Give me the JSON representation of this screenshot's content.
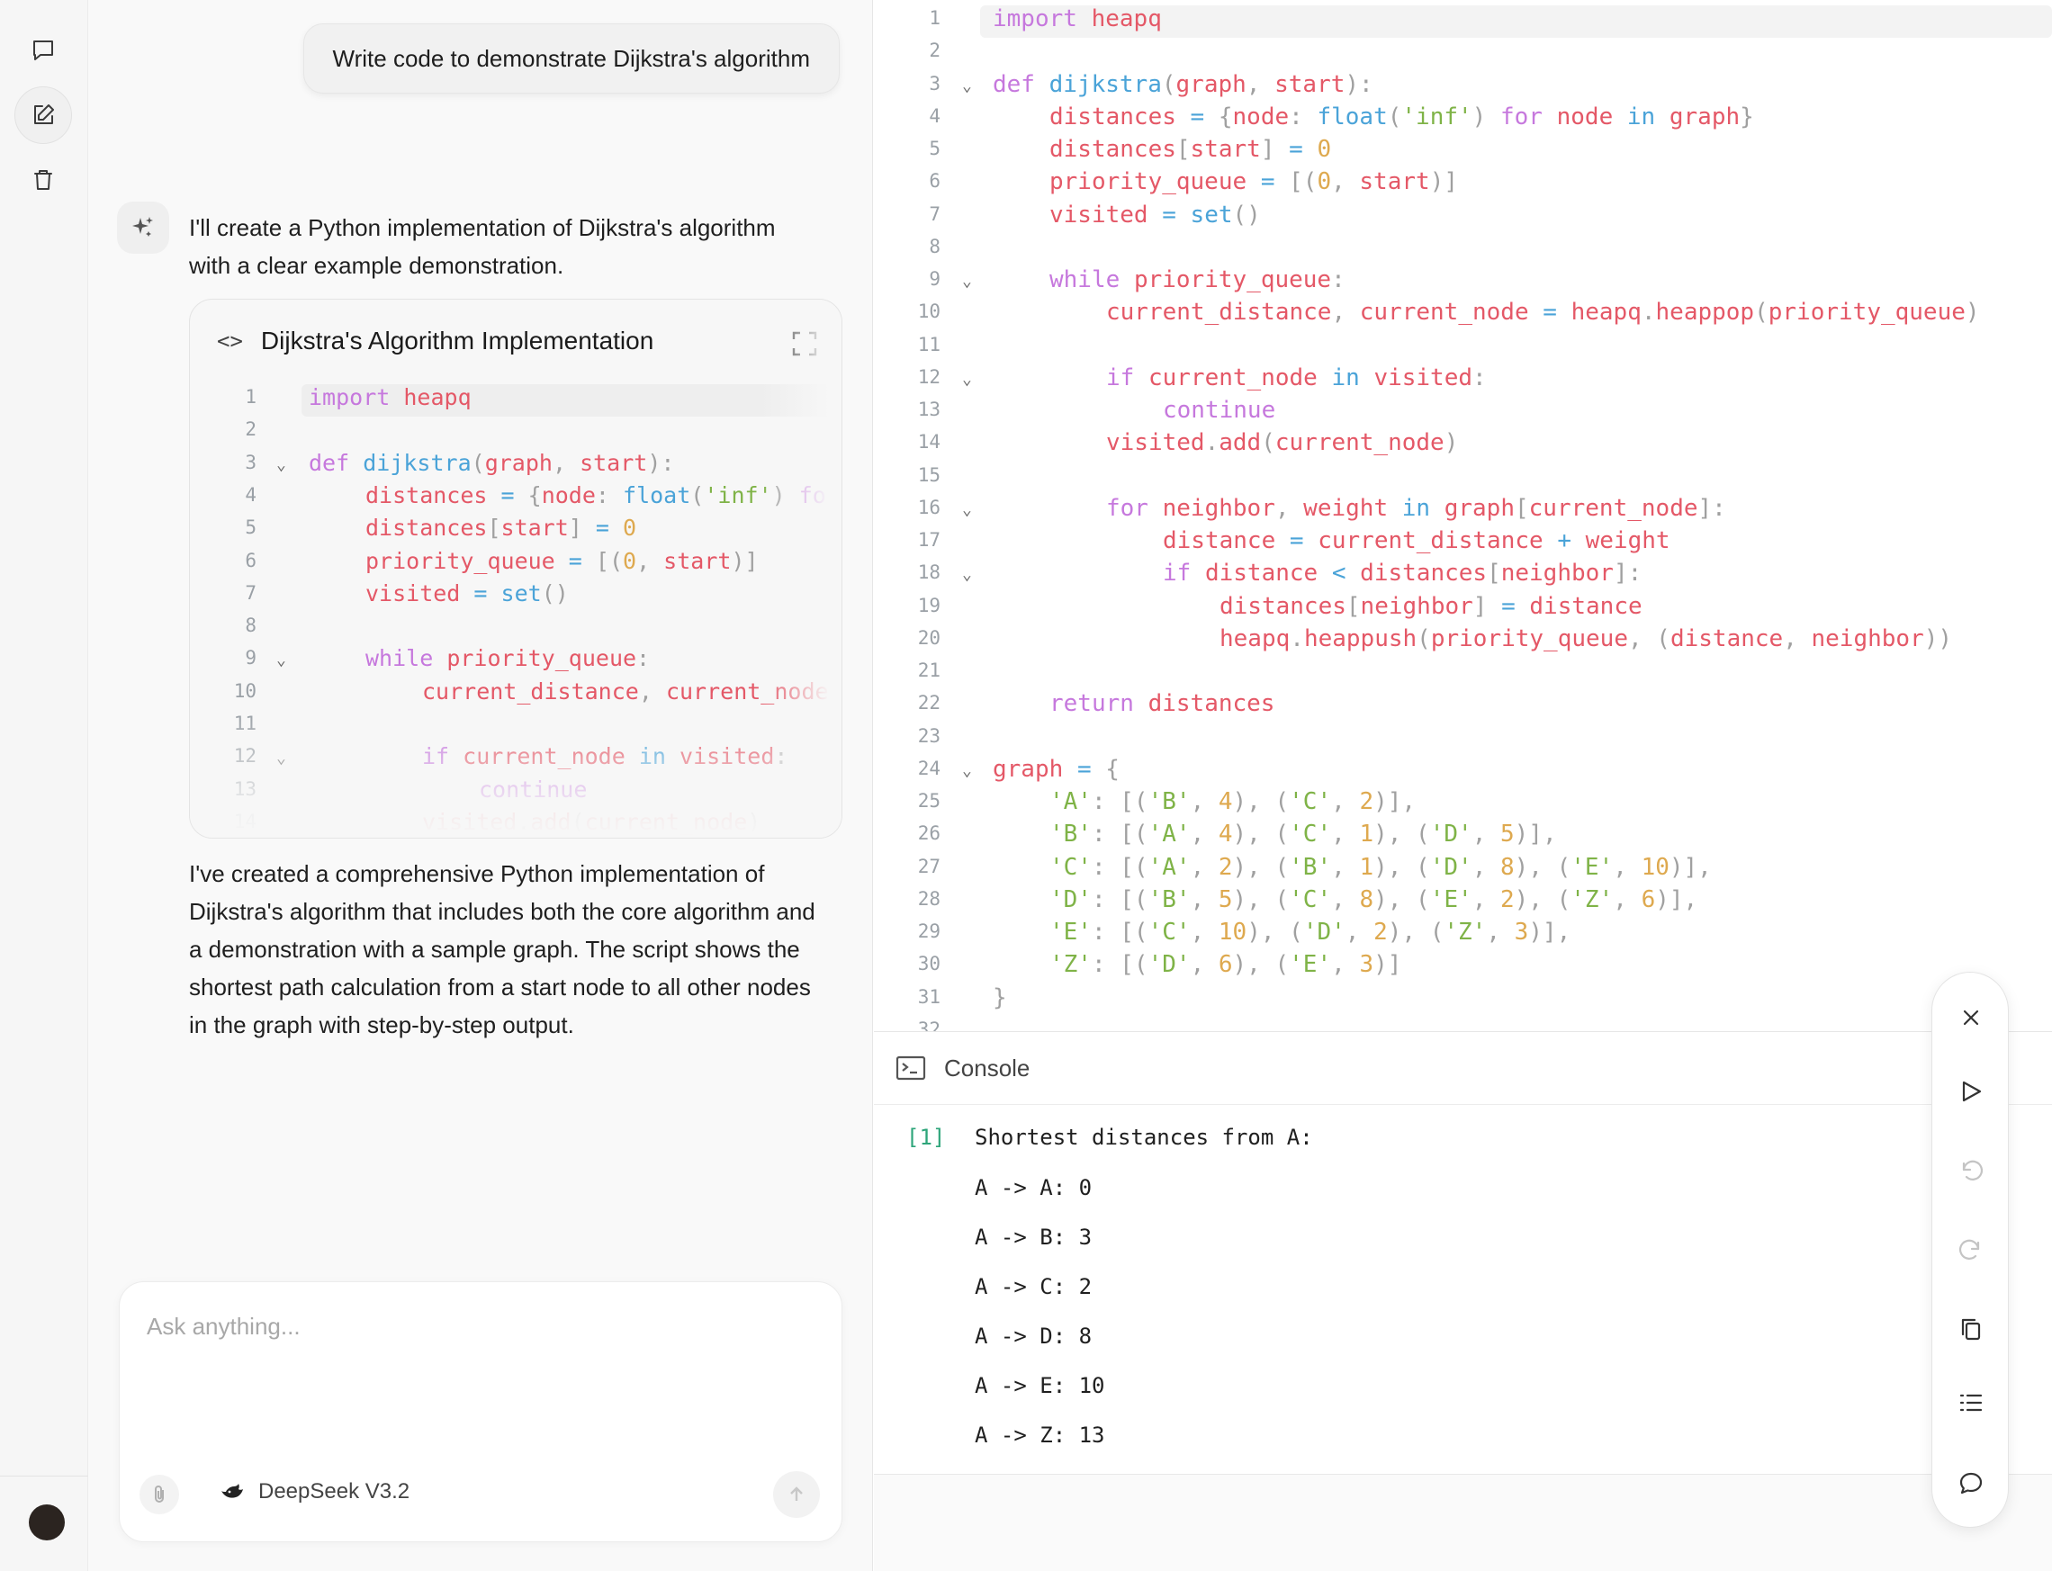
{
  "rail": {
    "items": [
      {
        "name": "chat-icon"
      },
      {
        "name": "new-chat-icon"
      },
      {
        "name": "trash-icon"
      }
    ]
  },
  "chat": {
    "user_message": "Write code to demonstrate Dijkstra's algorithm",
    "assistant_intro": "I'll create a Python implementation of Dijkstra's algorithm with a clear example demonstration.",
    "artifact_title": "Dijkstra's Algorithm Implementation",
    "artifact_icon": "code-icon",
    "assistant_outro": "I've created a comprehensive Python implementation of Dijkstra's algorithm that includes both the core algorithm and a demonstration with a sample graph. The script shows the shortest path calculation from a start node to all other nodes in the graph with step-by-step output.",
    "input_placeholder": "Ask anything...",
    "model_name": "DeepSeek V3.2"
  },
  "editor": {
    "lines": [
      {
        "n": "1",
        "fold": false,
        "indent": 0,
        "tokens": [
          [
            "kw",
            "import"
          ],
          [
            "pn",
            " "
          ],
          [
            "vr",
            "heapq"
          ]
        ]
      },
      {
        "n": "2",
        "fold": false,
        "indent": 0,
        "tokens": []
      },
      {
        "n": "3",
        "fold": true,
        "indent": 0,
        "tokens": [
          [
            "kw",
            "def"
          ],
          [
            "pn",
            " "
          ],
          [
            "fn",
            "dijkstra"
          ],
          [
            "pn",
            "("
          ],
          [
            "vr",
            "graph"
          ],
          [
            "pn",
            ", "
          ],
          [
            "vr",
            "start"
          ],
          [
            "pn",
            "):"
          ]
        ]
      },
      {
        "n": "4",
        "fold": false,
        "indent": 1,
        "tokens": [
          [
            "vr",
            "distances"
          ],
          [
            "pn",
            " "
          ],
          [
            "op",
            "="
          ],
          [
            "pn",
            " {"
          ],
          [
            "vr",
            "node"
          ],
          [
            "pn",
            ": "
          ],
          [
            "fn",
            "float"
          ],
          [
            "pn",
            "("
          ],
          [
            "st",
            "'inf'"
          ],
          [
            "pn",
            ") "
          ],
          [
            "kw",
            "for"
          ],
          [
            "pn",
            " "
          ],
          [
            "vr",
            "node"
          ],
          [
            "pn",
            " "
          ],
          [
            "op",
            "in"
          ],
          [
            "pn",
            " "
          ],
          [
            "vr",
            "graph"
          ],
          [
            "pn",
            "}"
          ]
        ]
      },
      {
        "n": "5",
        "fold": false,
        "indent": 1,
        "tokens": [
          [
            "vr",
            "distances"
          ],
          [
            "pn",
            "["
          ],
          [
            "vr",
            "start"
          ],
          [
            "pn",
            "] "
          ],
          [
            "op",
            "="
          ],
          [
            "pn",
            " "
          ],
          [
            "nm",
            "0"
          ]
        ]
      },
      {
        "n": "6",
        "fold": false,
        "indent": 1,
        "tokens": [
          [
            "vr",
            "priority_queue"
          ],
          [
            "pn",
            " "
          ],
          [
            "op",
            "="
          ],
          [
            "pn",
            " [("
          ],
          [
            "nm",
            "0"
          ],
          [
            "pn",
            ", "
          ],
          [
            "vr",
            "start"
          ],
          [
            "pn",
            ")]"
          ]
        ]
      },
      {
        "n": "7",
        "fold": false,
        "indent": 1,
        "tokens": [
          [
            "vr",
            "visited"
          ],
          [
            "pn",
            " "
          ],
          [
            "op",
            "="
          ],
          [
            "pn",
            " "
          ],
          [
            "fn",
            "set"
          ],
          [
            "pn",
            "()"
          ]
        ]
      },
      {
        "n": "8",
        "fold": false,
        "indent": 0,
        "tokens": []
      },
      {
        "n": "9",
        "fold": true,
        "indent": 1,
        "tokens": [
          [
            "kw",
            "while"
          ],
          [
            "pn",
            " "
          ],
          [
            "vr",
            "priority_queue"
          ],
          [
            "pn",
            ":"
          ]
        ]
      },
      {
        "n": "10",
        "fold": false,
        "indent": 2,
        "tokens": [
          [
            "vr",
            "current_distance"
          ],
          [
            "pn",
            ", "
          ],
          [
            "vr",
            "current_node"
          ],
          [
            "pn",
            " "
          ],
          [
            "op",
            "="
          ],
          [
            "pn",
            " "
          ],
          [
            "vr",
            "heapq"
          ],
          [
            "pn",
            "."
          ],
          [
            "vr",
            "heappop"
          ],
          [
            "pn",
            "("
          ],
          [
            "vr",
            "priority_queue"
          ],
          [
            "pn",
            ")"
          ]
        ]
      },
      {
        "n": "11",
        "fold": false,
        "indent": 0,
        "tokens": []
      },
      {
        "n": "12",
        "fold": true,
        "indent": 2,
        "tokens": [
          [
            "kw",
            "if"
          ],
          [
            "pn",
            " "
          ],
          [
            "vr",
            "current_node"
          ],
          [
            "pn",
            " "
          ],
          [
            "op",
            "in"
          ],
          [
            "pn",
            " "
          ],
          [
            "vr",
            "visited"
          ],
          [
            "pn",
            ":"
          ]
        ]
      },
      {
        "n": "13",
        "fold": false,
        "indent": 3,
        "tokens": [
          [
            "cd",
            "continue"
          ]
        ]
      },
      {
        "n": "14",
        "fold": false,
        "indent": 2,
        "tokens": [
          [
            "vr",
            "visited"
          ],
          [
            "pn",
            "."
          ],
          [
            "vr",
            "add"
          ],
          [
            "pn",
            "("
          ],
          [
            "vr",
            "current_node"
          ],
          [
            "pn",
            ")"
          ]
        ]
      },
      {
        "n": "15",
        "fold": false,
        "indent": 0,
        "tokens": []
      },
      {
        "n": "16",
        "fold": true,
        "indent": 2,
        "tokens": [
          [
            "kw",
            "for"
          ],
          [
            "pn",
            " "
          ],
          [
            "vr",
            "neighbor"
          ],
          [
            "pn",
            ", "
          ],
          [
            "vr",
            "weight"
          ],
          [
            "pn",
            " "
          ],
          [
            "op",
            "in"
          ],
          [
            "pn",
            " "
          ],
          [
            "vr",
            "graph"
          ],
          [
            "pn",
            "["
          ],
          [
            "vr",
            "current_node"
          ],
          [
            "pn",
            "]:"
          ]
        ]
      },
      {
        "n": "17",
        "fold": false,
        "indent": 3,
        "tokens": [
          [
            "vr",
            "distance"
          ],
          [
            "pn",
            " "
          ],
          [
            "op",
            "="
          ],
          [
            "pn",
            " "
          ],
          [
            "vr",
            "current_distance"
          ],
          [
            "pn",
            " "
          ],
          [
            "op",
            "+"
          ],
          [
            "pn",
            " "
          ],
          [
            "vr",
            "weight"
          ]
        ]
      },
      {
        "n": "18",
        "fold": true,
        "indent": 3,
        "tokens": [
          [
            "kw",
            "if"
          ],
          [
            "pn",
            " "
          ],
          [
            "vr",
            "distance"
          ],
          [
            "pn",
            " "
          ],
          [
            "op",
            "<"
          ],
          [
            "pn",
            " "
          ],
          [
            "vr",
            "distances"
          ],
          [
            "pn",
            "["
          ],
          [
            "vr",
            "neighbor"
          ],
          [
            "pn",
            "]:"
          ]
        ]
      },
      {
        "n": "19",
        "fold": false,
        "indent": 4,
        "tokens": [
          [
            "vr",
            "distances"
          ],
          [
            "pn",
            "["
          ],
          [
            "vr",
            "neighbor"
          ],
          [
            "pn",
            "] "
          ],
          [
            "op",
            "="
          ],
          [
            "pn",
            " "
          ],
          [
            "vr",
            "distance"
          ]
        ]
      },
      {
        "n": "20",
        "fold": false,
        "indent": 4,
        "tokens": [
          [
            "vr",
            "heapq"
          ],
          [
            "pn",
            "."
          ],
          [
            "vr",
            "heappush"
          ],
          [
            "pn",
            "("
          ],
          [
            "vr",
            "priority_queue"
          ],
          [
            "pn",
            ", ("
          ],
          [
            "vr",
            "distance"
          ],
          [
            "pn",
            ", "
          ],
          [
            "vr",
            "neighbor"
          ],
          [
            "pn",
            "))"
          ]
        ]
      },
      {
        "n": "21",
        "fold": false,
        "indent": 0,
        "tokens": []
      },
      {
        "n": "22",
        "fold": false,
        "indent": 1,
        "tokens": [
          [
            "kw",
            "return"
          ],
          [
            "pn",
            " "
          ],
          [
            "vr",
            "distances"
          ]
        ]
      },
      {
        "n": "23",
        "fold": false,
        "indent": 0,
        "tokens": []
      },
      {
        "n": "24",
        "fold": true,
        "indent": 0,
        "tokens": [
          [
            "vr",
            "graph"
          ],
          [
            "pn",
            " "
          ],
          [
            "op",
            "="
          ],
          [
            "pn",
            " {"
          ]
        ]
      },
      {
        "n": "25",
        "fold": false,
        "indent": 1,
        "tokens": [
          [
            "st",
            "'A'"
          ],
          [
            "pn",
            ": [("
          ],
          [
            "st",
            "'B'"
          ],
          [
            "pn",
            ", "
          ],
          [
            "nm",
            "4"
          ],
          [
            "pn",
            "), ("
          ],
          [
            "st",
            "'C'"
          ],
          [
            "pn",
            ", "
          ],
          [
            "nm",
            "2"
          ],
          [
            "pn",
            ")],"
          ]
        ]
      },
      {
        "n": "26",
        "fold": false,
        "indent": 1,
        "tokens": [
          [
            "st",
            "'B'"
          ],
          [
            "pn",
            ": [("
          ],
          [
            "st",
            "'A'"
          ],
          [
            "pn",
            ", "
          ],
          [
            "nm",
            "4"
          ],
          [
            "pn",
            "), ("
          ],
          [
            "st",
            "'C'"
          ],
          [
            "pn",
            ", "
          ],
          [
            "nm",
            "1"
          ],
          [
            "pn",
            "), ("
          ],
          [
            "st",
            "'D'"
          ],
          [
            "pn",
            ", "
          ],
          [
            "nm",
            "5"
          ],
          [
            "pn",
            ")],"
          ]
        ]
      },
      {
        "n": "27",
        "fold": false,
        "indent": 1,
        "tokens": [
          [
            "st",
            "'C'"
          ],
          [
            "pn",
            ": [("
          ],
          [
            "st",
            "'A'"
          ],
          [
            "pn",
            ", "
          ],
          [
            "nm",
            "2"
          ],
          [
            "pn",
            "), ("
          ],
          [
            "st",
            "'B'"
          ],
          [
            "pn",
            ", "
          ],
          [
            "nm",
            "1"
          ],
          [
            "pn",
            "), ("
          ],
          [
            "st",
            "'D'"
          ],
          [
            "pn",
            ", "
          ],
          [
            "nm",
            "8"
          ],
          [
            "pn",
            "), ("
          ],
          [
            "st",
            "'E'"
          ],
          [
            "pn",
            ", "
          ],
          [
            "nm",
            "10"
          ],
          [
            "pn",
            ")],"
          ]
        ]
      },
      {
        "n": "28",
        "fold": false,
        "indent": 1,
        "tokens": [
          [
            "st",
            "'D'"
          ],
          [
            "pn",
            ": [("
          ],
          [
            "st",
            "'B'"
          ],
          [
            "pn",
            ", "
          ],
          [
            "nm",
            "5"
          ],
          [
            "pn",
            "), ("
          ],
          [
            "st",
            "'C'"
          ],
          [
            "pn",
            ", "
          ],
          [
            "nm",
            "8"
          ],
          [
            "pn",
            "), ("
          ],
          [
            "st",
            "'E'"
          ],
          [
            "pn",
            ", "
          ],
          [
            "nm",
            "2"
          ],
          [
            "pn",
            "), ("
          ],
          [
            "st",
            "'Z'"
          ],
          [
            "pn",
            ", "
          ],
          [
            "nm",
            "6"
          ],
          [
            "pn",
            ")],"
          ]
        ]
      },
      {
        "n": "29",
        "fold": false,
        "indent": 1,
        "tokens": [
          [
            "st",
            "'E'"
          ],
          [
            "pn",
            ": [("
          ],
          [
            "st",
            "'C'"
          ],
          [
            "pn",
            ", "
          ],
          [
            "nm",
            "10"
          ],
          [
            "pn",
            "), ("
          ],
          [
            "st",
            "'D'"
          ],
          [
            "pn",
            ", "
          ],
          [
            "nm",
            "2"
          ],
          [
            "pn",
            "), ("
          ],
          [
            "st",
            "'Z'"
          ],
          [
            "pn",
            ", "
          ],
          [
            "nm",
            "3"
          ],
          [
            "pn",
            ")],"
          ]
        ]
      },
      {
        "n": "30",
        "fold": false,
        "indent": 1,
        "tokens": [
          [
            "st",
            "'Z'"
          ],
          [
            "pn",
            ": [("
          ],
          [
            "st",
            "'D'"
          ],
          [
            "pn",
            ", "
          ],
          [
            "nm",
            "6"
          ],
          [
            "pn",
            "), ("
          ],
          [
            "st",
            "'E'"
          ],
          [
            "pn",
            ", "
          ],
          [
            "nm",
            "3"
          ],
          [
            "pn",
            ")]"
          ]
        ]
      },
      {
        "n": "31",
        "fold": false,
        "indent": 0,
        "tokens": [
          [
            "pn",
            "}"
          ]
        ]
      },
      {
        "n": "32",
        "fold": false,
        "indent": 0,
        "tokens": []
      }
    ]
  },
  "console": {
    "label": "Console",
    "cell_index": "[1]",
    "output": [
      "Shortest distances from A:",
      "A -> A: 0",
      "A -> B: 3",
      "A -> C: 2",
      "A -> D: 8",
      "A -> E: 10",
      "A -> Z: 13"
    ]
  },
  "toolbar": {
    "items": [
      {
        "name": "close-icon",
        "enabled": true
      },
      {
        "name": "run-icon",
        "enabled": true
      },
      {
        "name": "undo-icon",
        "enabled": false
      },
      {
        "name": "redo-icon",
        "enabled": false
      },
      {
        "name": "copy-icon",
        "enabled": true
      },
      {
        "name": "list-icon",
        "enabled": true
      },
      {
        "name": "comment-icon",
        "enabled": true
      }
    ]
  }
}
